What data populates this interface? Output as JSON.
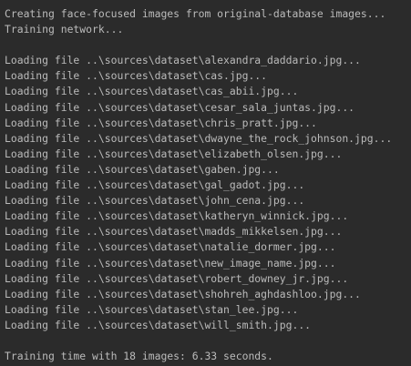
{
  "console": {
    "header_lines": [
      "Creating face-focused images from original-database images...",
      "Training network..."
    ],
    "loading_lines": [
      "Loading file ..\\sources\\dataset\\alexandra_daddario.jpg...",
      "Loading file ..\\sources\\dataset\\cas.jpg...",
      "Loading file ..\\sources\\dataset\\cas_abii.jpg...",
      "Loading file ..\\sources\\dataset\\cesar_sala_juntas.jpg...",
      "Loading file ..\\sources\\dataset\\chris_pratt.jpg...",
      "Loading file ..\\sources\\dataset\\dwayne_the_rock_johnson.jpg...",
      "Loading file ..\\sources\\dataset\\elizabeth_olsen.jpg...",
      "Loading file ..\\sources\\dataset\\gaben.jpg...",
      "Loading file ..\\sources\\dataset\\gal_gadot.jpg...",
      "Loading file ..\\sources\\dataset\\john_cena.jpg...",
      "Loading file ..\\sources\\dataset\\katheryn_winnick.jpg...",
      "Loading file ..\\sources\\dataset\\madds_mikkelsen.jpg...",
      "Loading file ..\\sources\\dataset\\natalie_dormer.jpg...",
      "Loading file ..\\sources\\dataset\\new_image_name.jpg...",
      "Loading file ..\\sources\\dataset\\robert_downey_jr.jpg...",
      "Loading file ..\\sources\\dataset\\shohreh_aghdashloo.jpg...",
      "Loading file ..\\sources\\dataset\\stan_lee.jpg...",
      "Loading file ..\\sources\\dataset\\will_smith.jpg..."
    ],
    "footer_line": "Training time with 18 images: 6.33 seconds.",
    "colors": {
      "background": "#2b2b2b",
      "text": "#bbbbbb"
    }
  }
}
